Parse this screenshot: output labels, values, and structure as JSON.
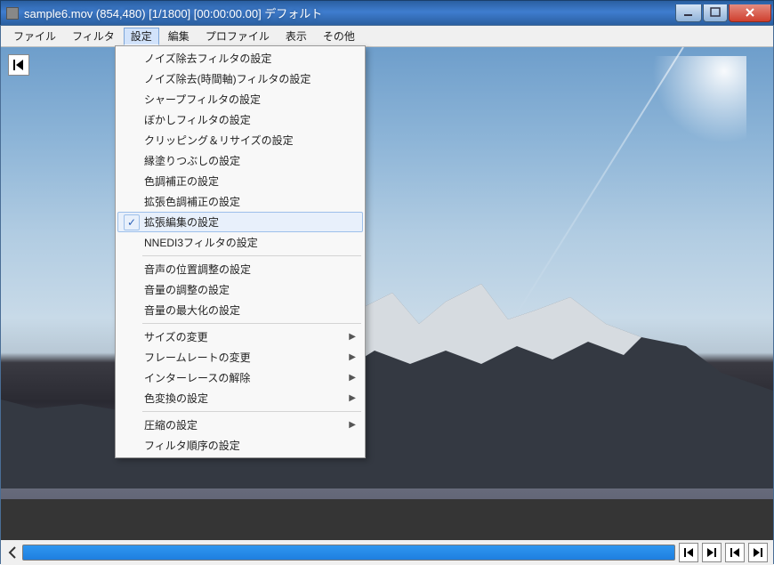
{
  "title": "sample6.mov (854,480)  [1/1800] [00:00:00.00]  デフォルト",
  "menubar": {
    "file": "ファイル",
    "filter": "フィルタ",
    "settings": "設定",
    "edit": "編集",
    "profile": "プロファイル",
    "view": "表示",
    "other": "その他"
  },
  "dropdown": {
    "noise_removal": "ノイズ除去フィルタの設定",
    "noise_removal_time": "ノイズ除去(時間軸)フィルタの設定",
    "sharpen": "シャープフィルタの設定",
    "blur": "ぼかしフィルタの設定",
    "clipping_resize": "クリッピング＆リサイズの設定",
    "edge_fill": "縁塗りつぶしの設定",
    "color_correction": "色調補正の設定",
    "ext_color_correction": "拡張色調補正の設定",
    "ext_editing": "拡張編集の設定",
    "nnedi3": "NNEDI3フィルタの設定",
    "audio_position": "音声の位置調整の設定",
    "volume_adjust": "音量の調整の設定",
    "volume_max": "音量の最大化の設定",
    "size_change": "サイズの変更",
    "framerate_change": "フレームレートの変更",
    "deinterlace": "インターレースの解除",
    "color_convert": "色変換の設定",
    "compression": "圧縮の設定",
    "filter_order": "フィルタ順序の設定"
  }
}
